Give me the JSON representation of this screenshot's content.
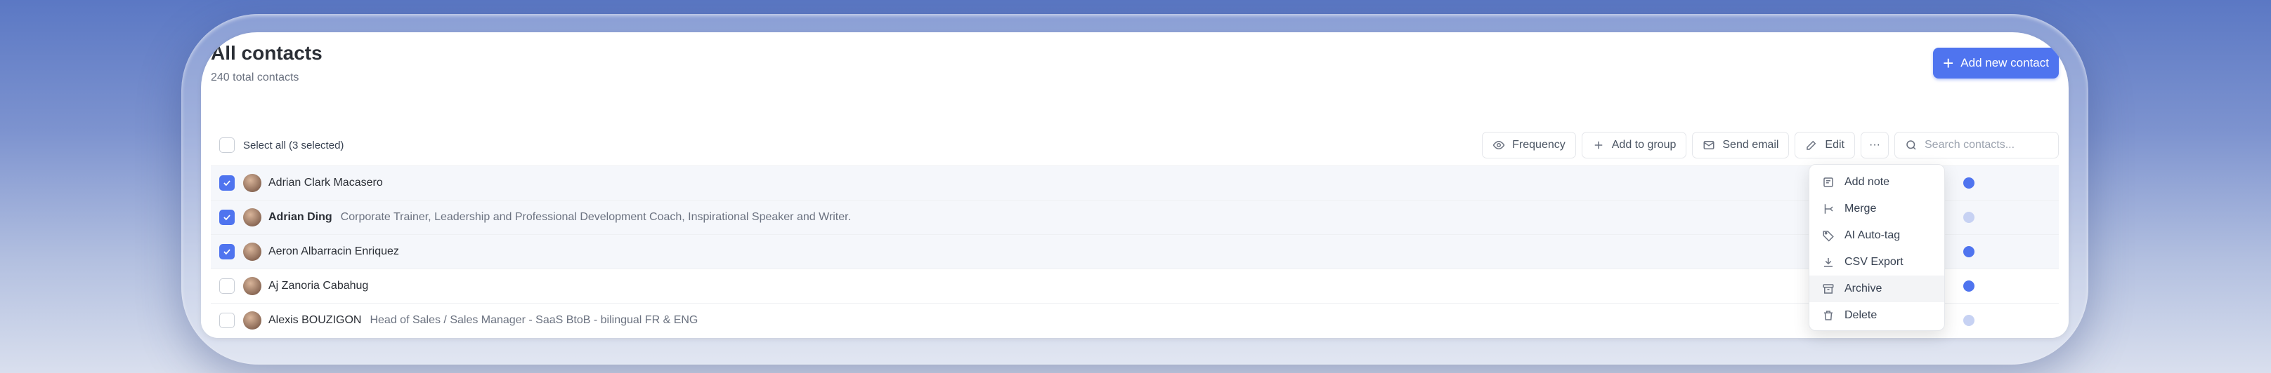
{
  "header": {
    "title": "All contacts",
    "subtitle": "240 total contacts",
    "add_button_label": "Add new contact"
  },
  "toolbar": {
    "select_all_label": "Select all (3 selected)",
    "frequency_label": "Frequency",
    "add_to_group_label": "Add to group",
    "send_email_label": "Send email",
    "edit_label": "Edit",
    "more_label": "···",
    "search_placeholder": "Search contacts..."
  },
  "contacts": [
    {
      "name": "Adrian Clark Macasero",
      "description": "",
      "selected": true
    },
    {
      "name": "Adrian Ding",
      "description": "Corporate Trainer, Leadership and Professional Development Coach, Inspirational Speaker and Writer.",
      "selected": true
    },
    {
      "name": "Aeron Albarracin Enriquez",
      "description": "",
      "selected": true
    },
    {
      "name": "Aj Zanoria Cabahug",
      "description": "",
      "selected": false
    },
    {
      "name": "Alexis BOUZIGON",
      "description": "Head of Sales / Sales Manager - SaaS BtoB - bilingual FR & ENG",
      "selected": false
    }
  ],
  "menu": {
    "items": [
      {
        "label": "Add note",
        "icon": "note-icon"
      },
      {
        "label": "Merge",
        "icon": "merge-icon"
      },
      {
        "label": "AI Auto-tag",
        "icon": "tag-icon"
      },
      {
        "label": "CSV Export",
        "icon": "download-icon"
      },
      {
        "label": "Archive",
        "icon": "archive-icon"
      },
      {
        "label": "Delete",
        "icon": "trash-icon"
      }
    ]
  },
  "colors": {
    "accent": "#4f74ef"
  }
}
